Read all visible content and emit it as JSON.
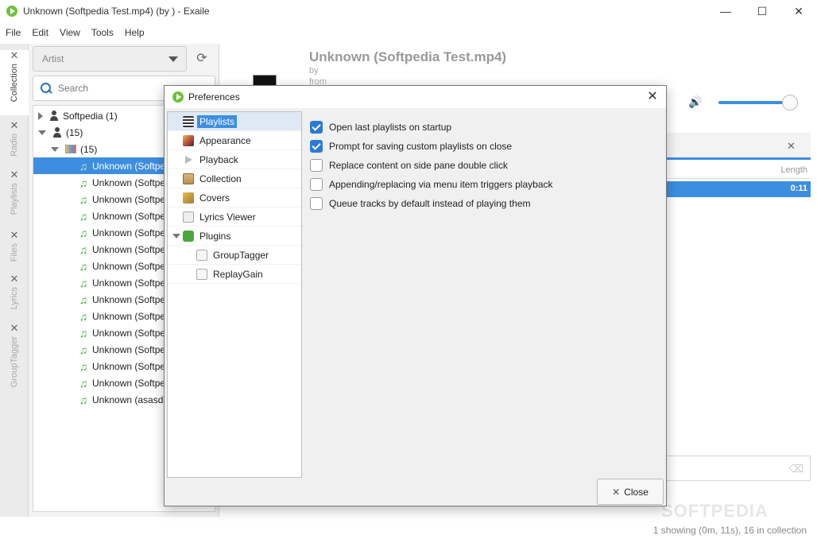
{
  "window": {
    "title": "Unknown (Softpedia Test.mp4) (by ) - Exaile",
    "minimize": "—",
    "maximize": "☐",
    "close": "✕"
  },
  "menu": [
    "File",
    "Edit",
    "View",
    "Tools",
    "Help"
  ],
  "side_tabs": [
    {
      "label": "Collection",
      "active": true
    },
    {
      "label": "Radio",
      "active": false
    },
    {
      "label": "Playlists",
      "active": false
    },
    {
      "label": "Files",
      "active": false
    },
    {
      "label": "Lyrics",
      "active": false
    },
    {
      "label": "GroupTagger",
      "active": false
    }
  ],
  "collection": {
    "view_by": "Artist",
    "search_placeholder": "Search",
    "tree": [
      {
        "label": "Softpedia (1)",
        "type": "artist",
        "expanded": false,
        "depth": 0
      },
      {
        "label": "(15)",
        "type": "artist",
        "expanded": true,
        "depth": 0
      },
      {
        "label": "(15)",
        "type": "album",
        "expanded": true,
        "depth": 1
      },
      {
        "label": "Unknown (Softpe",
        "type": "track",
        "selected": true
      },
      {
        "label": "Unknown (Softpe",
        "type": "track"
      },
      {
        "label": "Unknown (Softpe",
        "type": "track"
      },
      {
        "label": "Unknown (Softpe",
        "type": "track"
      },
      {
        "label": "Unknown (Softpe",
        "type": "track"
      },
      {
        "label": "Unknown (Softpe",
        "type": "track"
      },
      {
        "label": "Unknown (Softpe",
        "type": "track"
      },
      {
        "label": "Unknown (Softpe",
        "type": "track"
      },
      {
        "label": "Unknown (Softpe",
        "type": "track"
      },
      {
        "label": "Unknown (Softpe",
        "type": "track"
      },
      {
        "label": "Unknown (Softpe",
        "type": "track"
      },
      {
        "label": "Unknown (Softpe",
        "type": "track"
      },
      {
        "label": "Unknown (Softpe",
        "type": "track"
      },
      {
        "label": "Unknown (Softpe",
        "type": "track"
      },
      {
        "label": "Unknown (asasda",
        "type": "track"
      }
    ]
  },
  "now_playing": {
    "title": "Unknown (Softpedia Test.mp4)",
    "by": "by",
    "from": "from"
  },
  "volume": {
    "level": 0.95
  },
  "playlist": {
    "length_header": "Length",
    "rows": [
      {
        "length": "0:11"
      }
    ]
  },
  "watermark": "SOFTPEDIA",
  "status": "1 showing (0m, 11s), 16 in collection",
  "dialog": {
    "title": "Preferences",
    "categories": [
      {
        "label": "Playlists",
        "icon": "playlists-icon",
        "selected": true,
        "depth": 0
      },
      {
        "label": "Appearance",
        "icon": "appearance-icon",
        "depth": 0
      },
      {
        "label": "Playback",
        "icon": "playback-icon",
        "depth": 0
      },
      {
        "label": "Collection",
        "icon": "collection-icon",
        "depth": 0
      },
      {
        "label": "Covers",
        "icon": "covers-icon",
        "depth": 0
      },
      {
        "label": "Lyrics Viewer",
        "icon": "lyrics-icon",
        "depth": 0
      },
      {
        "label": "Plugins",
        "icon": "plugins-icon",
        "depth": 0,
        "expanded": true
      },
      {
        "label": "GroupTagger",
        "icon": "plugin-icon",
        "depth": 1
      },
      {
        "label": "ReplayGain",
        "icon": "plugin-icon",
        "depth": 1
      }
    ],
    "options": [
      {
        "label": "Open last playlists on startup",
        "checked": true
      },
      {
        "label": "Prompt for saving custom playlists on close",
        "checked": true
      },
      {
        "label": "Replace content on side pane double click",
        "checked": false
      },
      {
        "label": "Appending/replacing via menu item triggers playback",
        "checked": false
      },
      {
        "label": "Queue tracks by default instead of playing them",
        "checked": false
      }
    ],
    "close_label": "Close"
  },
  "colors": {
    "accent": "#3d8ee0",
    "checkbox": "#2d7ad6",
    "brand_green": "#6ec13f"
  }
}
